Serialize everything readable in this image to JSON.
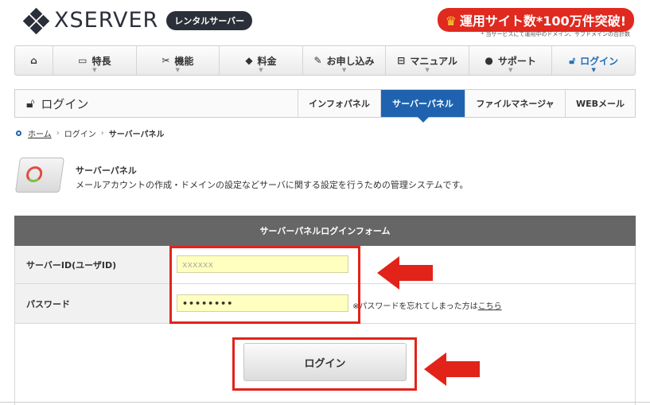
{
  "header": {
    "logo_text": "XSERVER",
    "badge": "レンタルサーバー",
    "promo": "運用サイト数*100万件突破!",
    "promo_note": "* 当サービスにて運用中のドメイン、サブドメインの合計数"
  },
  "nav": {
    "items": [
      {
        "label": "",
        "icon": "home-icon"
      },
      {
        "label": "特長",
        "icon": "monitor-icon"
      },
      {
        "label": "機能",
        "icon": "tools-icon"
      },
      {
        "label": "料金",
        "icon": "tag-icon"
      },
      {
        "label": "お申し込み",
        "icon": "pencil-icon"
      },
      {
        "label": "マニュアル",
        "icon": "book-icon"
      },
      {
        "label": "サポート",
        "icon": "person-icon"
      },
      {
        "label": "ログイン",
        "icon": "lock-icon"
      }
    ]
  },
  "login_bar": {
    "title": "ログイン",
    "tabs": [
      "インフォパネル",
      "サーバーパネル",
      "ファイルマネージャ",
      "WEBメール"
    ],
    "active_tab": "サーバーパネル"
  },
  "breadcrumb": [
    "ホーム",
    "ログイン",
    "サーバーパネル"
  ],
  "panel": {
    "title": "サーバーパネル",
    "description": "メールアカウントの作成・ドメインの設定などサーバに関する設定を行うための管理システムです。"
  },
  "form": {
    "heading": "サーバーパネルログインフォーム",
    "server_id_label": "サーバーID(ユーザID)",
    "server_id_value": "xxxxxx",
    "password_label": "パスワード",
    "password_value": "••••••••",
    "forgot_text": "※パスワードを忘れてしまった方は",
    "forgot_link": "こちら",
    "login_button": "ログイン"
  },
  "colors": {
    "accent": "#1f63b0",
    "highlight": "#e2231a",
    "input_bg": "#ffffc0"
  }
}
